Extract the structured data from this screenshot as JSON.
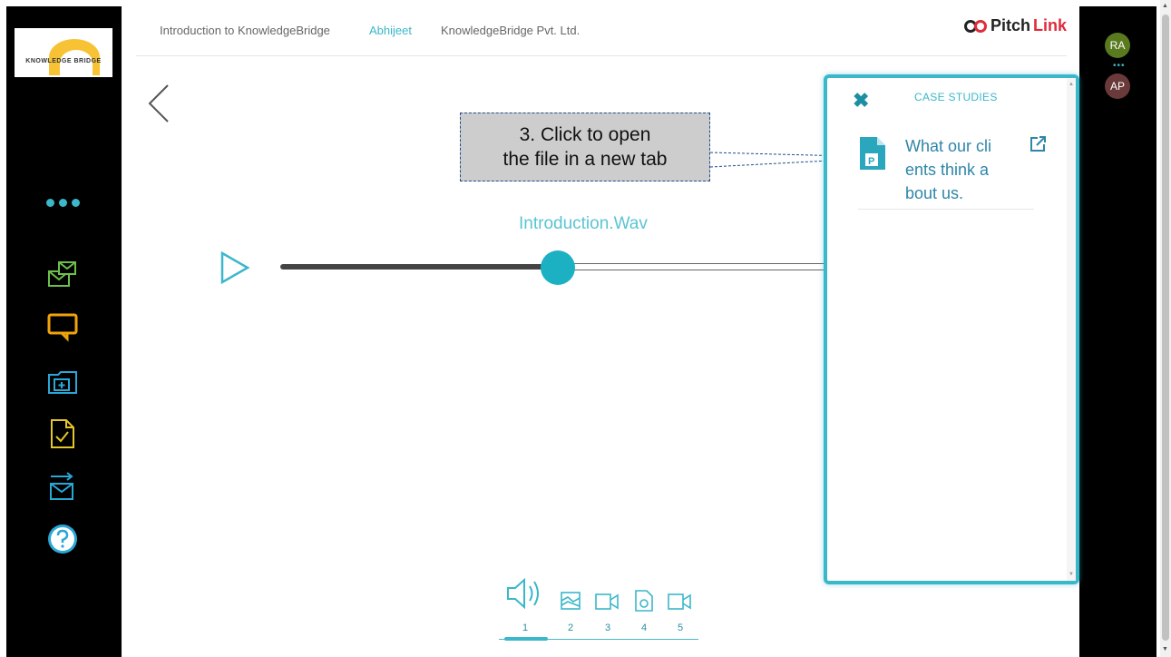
{
  "header": {
    "presentation": "Introduction to KnowledgeBridge",
    "user": "Abhijeet",
    "company": "KnowledgeBridge Pvt. Ltd.",
    "brand_pitch": "Pitch",
    "brand_link": "Link"
  },
  "logo": {
    "text": "KNOWLEDGE BRIDGE"
  },
  "avatars": [
    {
      "initials": "RA",
      "color": "#5a7a1f"
    },
    {
      "initials": "AP",
      "color": "#6a3a3a"
    }
  ],
  "media": {
    "file_title": "Introduction.Wav",
    "progress": 0.5
  },
  "media_nav": {
    "items": [
      {
        "num": "1",
        "icon": "audio-icon"
      },
      {
        "num": "2",
        "icon": "image-icon"
      },
      {
        "num": "3",
        "icon": "video-icon"
      },
      {
        "num": "4",
        "icon": "document-icon"
      },
      {
        "num": "5",
        "icon": "video-icon"
      }
    ]
  },
  "tooltip": {
    "line1": "3. Click to open",
    "line2": "the file in a new tab"
  },
  "panel": {
    "title": "CASE STUDIES",
    "file_name": "What our clients think about us.",
    "file_icon": "ppt-file-icon"
  },
  "colors": {
    "accent": "#3ab7c9",
    "brand_red": "#e02b3a"
  }
}
